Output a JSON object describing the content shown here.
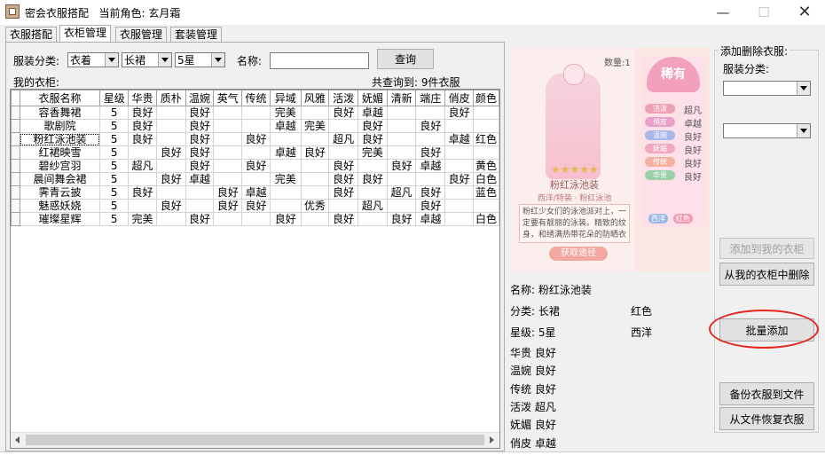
{
  "window": {
    "title": "密会衣服搭配",
    "role_label": "当前角色:",
    "role": "玄月霜"
  },
  "tabs": [
    "衣服搭配",
    "衣柜管理",
    "衣服管理",
    "套装管理"
  ],
  "filter": {
    "category_label": "服装分类:",
    "category": "衣着",
    "subcategory": "长裙",
    "level": "5星",
    "name_label": "名称:",
    "name_value": "",
    "search_button": "查询"
  },
  "wardrobe": {
    "title": "我的衣柜:",
    "count_text": "共查询到:  9件衣服",
    "columns": [
      "衣服名称",
      "星级",
      "华贵",
      "质朴",
      "温婉",
      "英气",
      "传统",
      "异域",
      "风雅",
      "活泼",
      "妩媚",
      "清新",
      "端庄",
      "俏皮",
      "颜色"
    ],
    "rows": [
      [
        "容香舞裙",
        "5",
        "良好",
        "",
        "良好",
        "",
        "",
        "完美",
        "",
        "良好",
        "卓越",
        "",
        "",
        "良好",
        ""
      ],
      [
        "歌剧院",
        "5",
        "良好",
        "",
        "良好",
        "",
        "",
        "卓越",
        "完美",
        "",
        "良好",
        "",
        "良好",
        "",
        ""
      ],
      [
        "粉红泳池装",
        "5",
        "良好",
        "",
        "良好",
        "",
        "良好",
        "",
        "",
        "超凡",
        "良好",
        "",
        "",
        "卓越",
        "红色"
      ],
      [
        "红裙映雪",
        "5",
        "",
        "良好",
        "良好",
        "",
        "",
        "卓越",
        "良好",
        "",
        "完美",
        "",
        "良好",
        "",
        ""
      ],
      [
        "碧纱宫羽",
        "5",
        "超凡",
        "",
        "良好",
        "",
        "良好",
        "",
        "",
        "良好",
        "",
        "良好",
        "卓越",
        "",
        "黄色"
      ],
      [
        "晨间舞会裙",
        "5",
        "",
        "良好",
        "卓越",
        "",
        "",
        "完美",
        "",
        "良好",
        "良好",
        "",
        "",
        "良好",
        "白色"
      ],
      [
        "霁青云披",
        "5",
        "良好",
        "",
        "",
        "良好",
        "卓越",
        "",
        "",
        "良好",
        "",
        "超凡",
        "良好",
        "",
        "蓝色"
      ],
      [
        "魅惑妖娆",
        "5",
        "",
        "良好",
        "",
        "良好",
        "良好",
        "",
        "优秀",
        "",
        "超凡",
        "",
        "良好",
        "",
        ""
      ],
      [
        "璀璨星辉",
        "5",
        "完美",
        "",
        "良好",
        "",
        "",
        "良好",
        "",
        "良好",
        "",
        "良好",
        "卓越",
        "",
        "白色"
      ]
    ]
  },
  "card": {
    "quantity": "数量:1",
    "rarity": "稀有",
    "name": "粉红泳池装",
    "subtitle": "西洋/特装 · 粉红泳池",
    "description": "粉红少女们的泳池派对上，一定要有靓丽的泳装。精致的纹身，和绣满热带花朵的防晒衣",
    "get_button": "获取途径",
    "attrs": [
      {
        "name": "活泼",
        "value": "超凡"
      },
      {
        "name": "俏皮",
        "value": "卓越"
      },
      {
        "name": "温婉",
        "value": "良好"
      },
      {
        "name": "妩媚",
        "value": "良好"
      },
      {
        "name": "传统",
        "value": "良好"
      },
      {
        "name": "华贵",
        "value": "良好"
      }
    ],
    "tags": [
      "西洋",
      "红色"
    ]
  },
  "detail": {
    "name_label": "名称:",
    "name": "粉红泳池装",
    "category_label": "分类:",
    "category": "长裙",
    "color": "红色",
    "level_label": "星级:",
    "level": "5星",
    "style": "西洋",
    "attrs": [
      {
        "name": "华贵",
        "value": "良好"
      },
      {
        "name": "温婉",
        "value": "良好"
      },
      {
        "name": "传统",
        "value": "良好"
      },
      {
        "name": "活泼",
        "value": "超凡"
      },
      {
        "name": "妩媚",
        "value": "良好"
      },
      {
        "name": "俏皮",
        "value": "卓越"
      }
    ]
  },
  "side": {
    "group_title": "添加删除衣服:",
    "category_label": "服装分类:",
    "select1": "",
    "select2": "",
    "add_button": "添加到我的衣柜",
    "delete_button": "从我的衣柜中删除",
    "batch_button": "批量添加",
    "backup_button": "备份衣服到文件",
    "restore_button": "从文件恢复衣服"
  }
}
